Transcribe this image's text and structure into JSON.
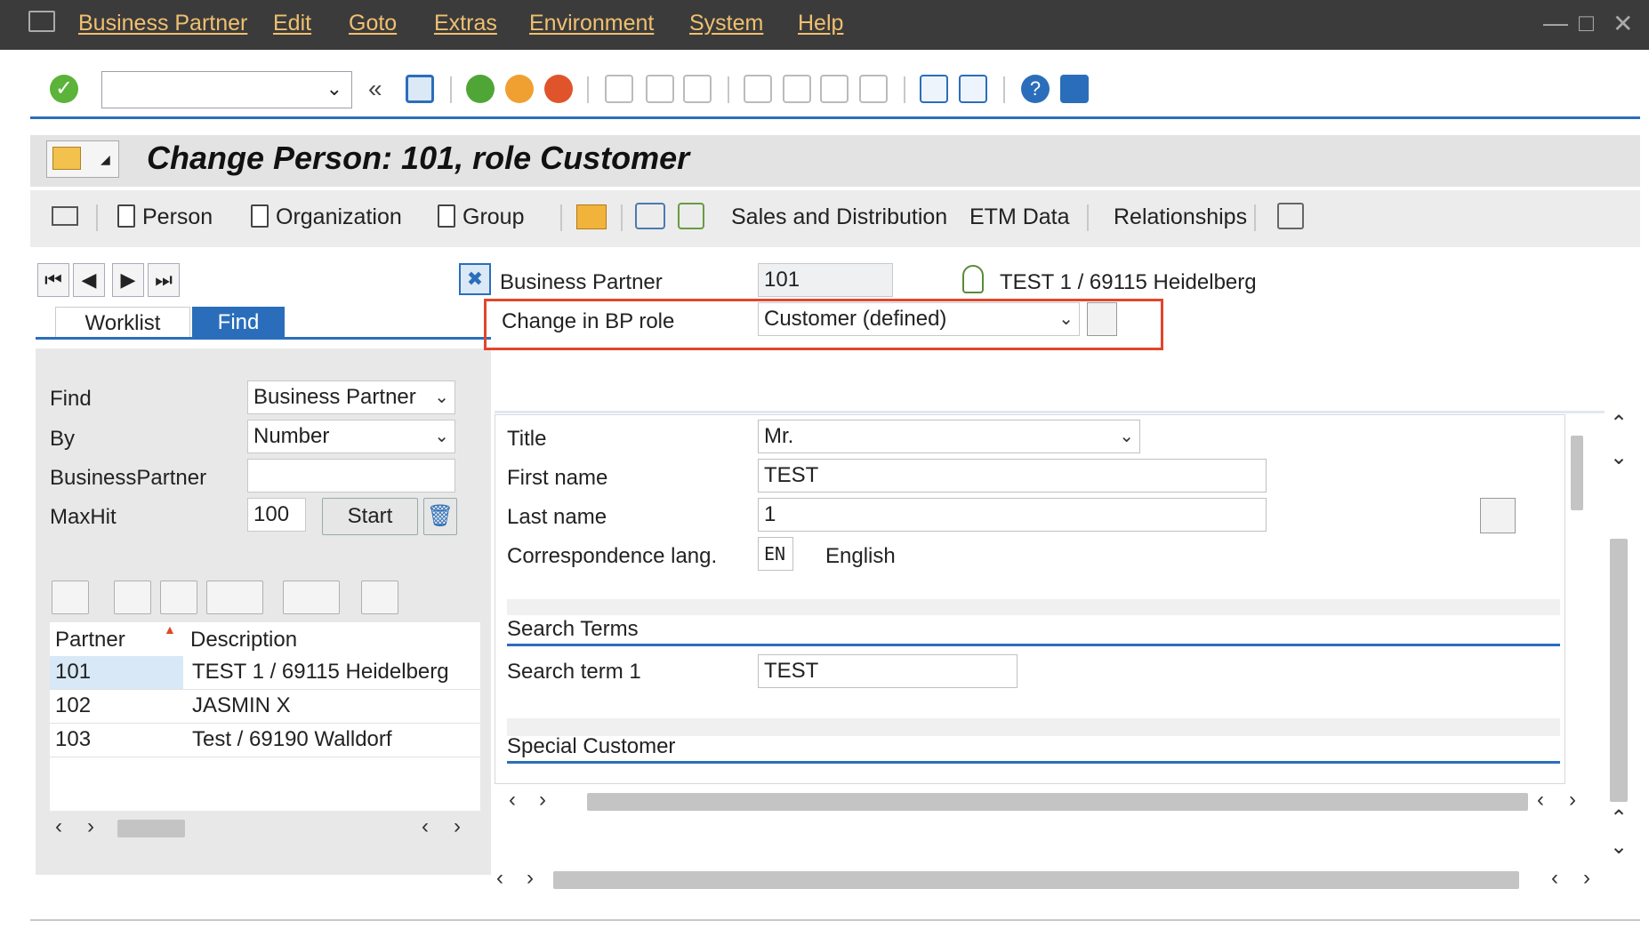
{
  "menu": {
    "items": [
      "Business Partner",
      "Edit",
      "Goto",
      "Extras",
      "Environment",
      "System",
      "Help"
    ]
  },
  "toolbar": {
    "command_value": "",
    "icons": [
      "enter-icon",
      "back-icon",
      "save-icon",
      "back-green-icon",
      "exit-icon",
      "cancel-icon",
      "print-icon",
      "find-icon",
      "find-next-icon",
      "first-page-icon",
      "prev-page-icon",
      "next-page-icon",
      "last-page-icon",
      "new-session-icon",
      "shortcut-icon",
      "help-icon",
      "settings-icon"
    ]
  },
  "title": "Change Person: 101, role Customer",
  "app_toolbar": {
    "person": "Person",
    "organization": "Organization",
    "group": "Group",
    "sales": "Sales and Distribution",
    "etm": "ETM Data",
    "relationships": "Relationships"
  },
  "tabs": {
    "worklist": "Worklist",
    "find": "Find"
  },
  "find_panel": {
    "find_label": "Find",
    "find_value": "Business Partner",
    "by_label": "By",
    "by_value": "Number",
    "bp_label": "BusinessPartner",
    "bp_value": "",
    "maxhit_label": "MaxHit",
    "maxhit_value": "100",
    "start_label": "Start"
  },
  "result_table": {
    "columns": [
      "Partner",
      "Description"
    ],
    "rows": [
      {
        "partner": "101",
        "description": "TEST 1 / 69115 Heidelberg"
      },
      {
        "partner": "102",
        "description": "JASMIN X"
      },
      {
        "partner": "103",
        "description": "Test / 69190 Walldorf"
      }
    ]
  },
  "header": {
    "bp_label": "Business Partner",
    "bp_value": "101",
    "bp_desc": "TEST 1 / 69115 Heidelberg",
    "role_label": "Change in BP role",
    "role_value": "Customer (defined)"
  },
  "form": {
    "title_label": "Title",
    "title_value": "Mr.",
    "first_label": "First name",
    "first_value": "TEST",
    "last_label": "Last name",
    "last_value": "1",
    "lang_label": "Correspondence lang.",
    "lang_code": "EN",
    "lang_name": "English",
    "search_header": "Search Terms",
    "search1_label": "Search term 1",
    "search1_value": "TEST",
    "special_header": "Special Customer"
  },
  "colors": {
    "menubar": "#3b3b3b",
    "accent": "#2a6ebb",
    "highlight_box": "#e2452c",
    "selected_tab": "#2a6ebb"
  }
}
